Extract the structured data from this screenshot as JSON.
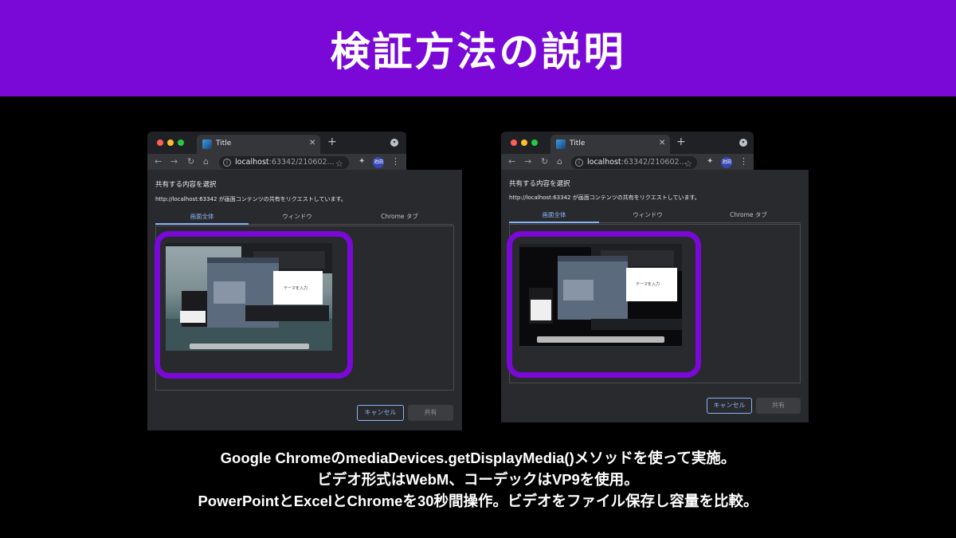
{
  "slide": {
    "title": "検証方法の説明",
    "accent_color": "#7a08d6",
    "caption_lines": [
      "Google ChromeのmediaDevices.getDisplayMedia()メソッドを使って実施。",
      "ビデオ形式はWebM、コーデックはVP9を使用。",
      "PowerPointとExcelとChromeを30秒間操作。ビデオをファイル保存し容量を比較。"
    ]
  },
  "browser": {
    "tab_title": "Title",
    "url_host": "localhost",
    "url_rest": ":63342/210602...",
    "profile_label": "池田",
    "traffic_lights": [
      "#ff5f57",
      "#febc2e",
      "#28c840"
    ]
  },
  "dialog": {
    "title": "共有する内容を選択",
    "subtitle": "http://localhost:63342 が画面コンテンツの共有をリクエストしています。",
    "tabs": [
      "画面全体",
      "ウィンドウ",
      "Chrome タブ"
    ],
    "active_tab": "画面全体",
    "cancel_label": "キャンセル",
    "share_label": "共有"
  },
  "icons": {
    "close": "close-icon",
    "new_tab": "plus-icon",
    "back": "arrow-left-icon",
    "forward": "arrow-right-icon",
    "reload": "reload-icon",
    "home": "home-icon",
    "info": "info-icon",
    "bookmark": "star-icon",
    "extensions": "puzzle-icon",
    "menu": "kebab-icon"
  }
}
